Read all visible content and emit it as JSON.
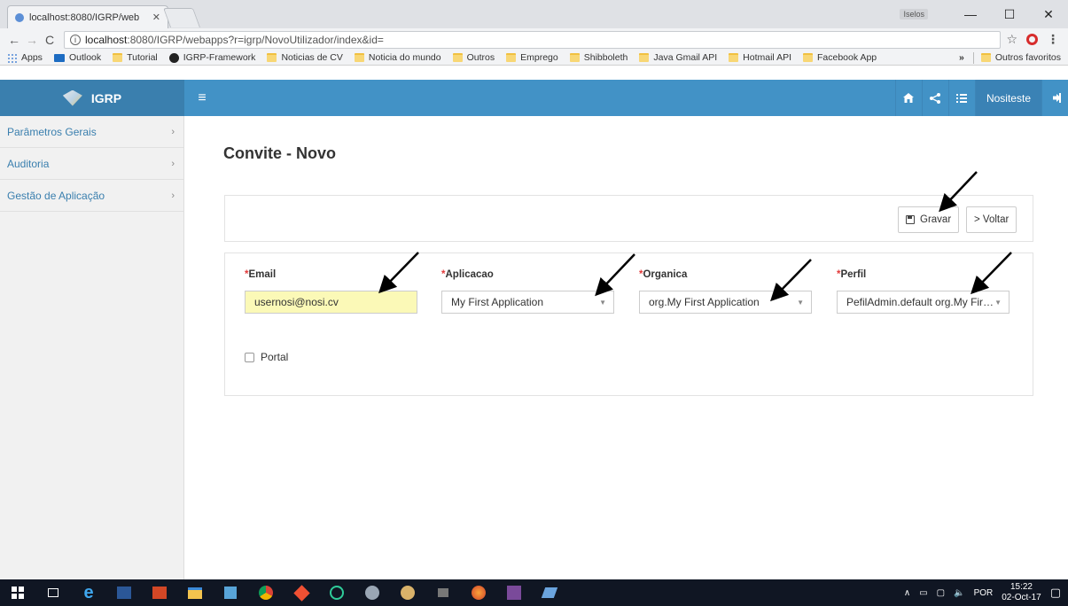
{
  "browser": {
    "tab_title": "localhost:8080/IGRP/web",
    "tab_close": "✕",
    "user_badge": "Iselos",
    "window_controls": [
      "—",
      "☐",
      "✕"
    ],
    "nav": {
      "back": "←",
      "forward": "→",
      "reload": "C"
    },
    "url_host": "localhost",
    "url_rest": ":8080/IGRP/webapps?r=igrp/NovoUtilizador/index&id=",
    "bookmarks": [
      "Apps",
      "Outlook",
      "Tutorial",
      "IGRP-Framework",
      "Noticias de CV",
      "Noticia do mundo",
      "Outros",
      "Emprego",
      "Shibboleth",
      "Java Gmail API",
      "Hotmail API",
      "Facebook App"
    ],
    "bookmarks_more": "»",
    "other_bookmarks": "Outros favoritos"
  },
  "app": {
    "brand": "IGRP",
    "user": "Nositeste"
  },
  "sidebar": {
    "items": [
      {
        "label": "Parâmetros Gerais"
      },
      {
        "label": "Auditoria"
      },
      {
        "label": "Gestão de Aplicação"
      }
    ]
  },
  "page": {
    "title": "Convite - Novo",
    "save_label": "Gravar",
    "back_label": "> Voltar"
  },
  "form": {
    "required_mark": "*",
    "email": {
      "label": "Email",
      "value": "usernosi@nosi.cv"
    },
    "aplicacao": {
      "label": "Aplicacao",
      "value": "My First Application"
    },
    "organica": {
      "label": "Organica",
      "value": "org.My First Application"
    },
    "perfil": {
      "label": "Perfil",
      "value": "PefilAdmin.default org.My Fir…"
    },
    "portal_label": "Portal"
  },
  "taskbar": {
    "tray_lang": "POR",
    "time": "15:22",
    "date": "02-Oct-17"
  }
}
